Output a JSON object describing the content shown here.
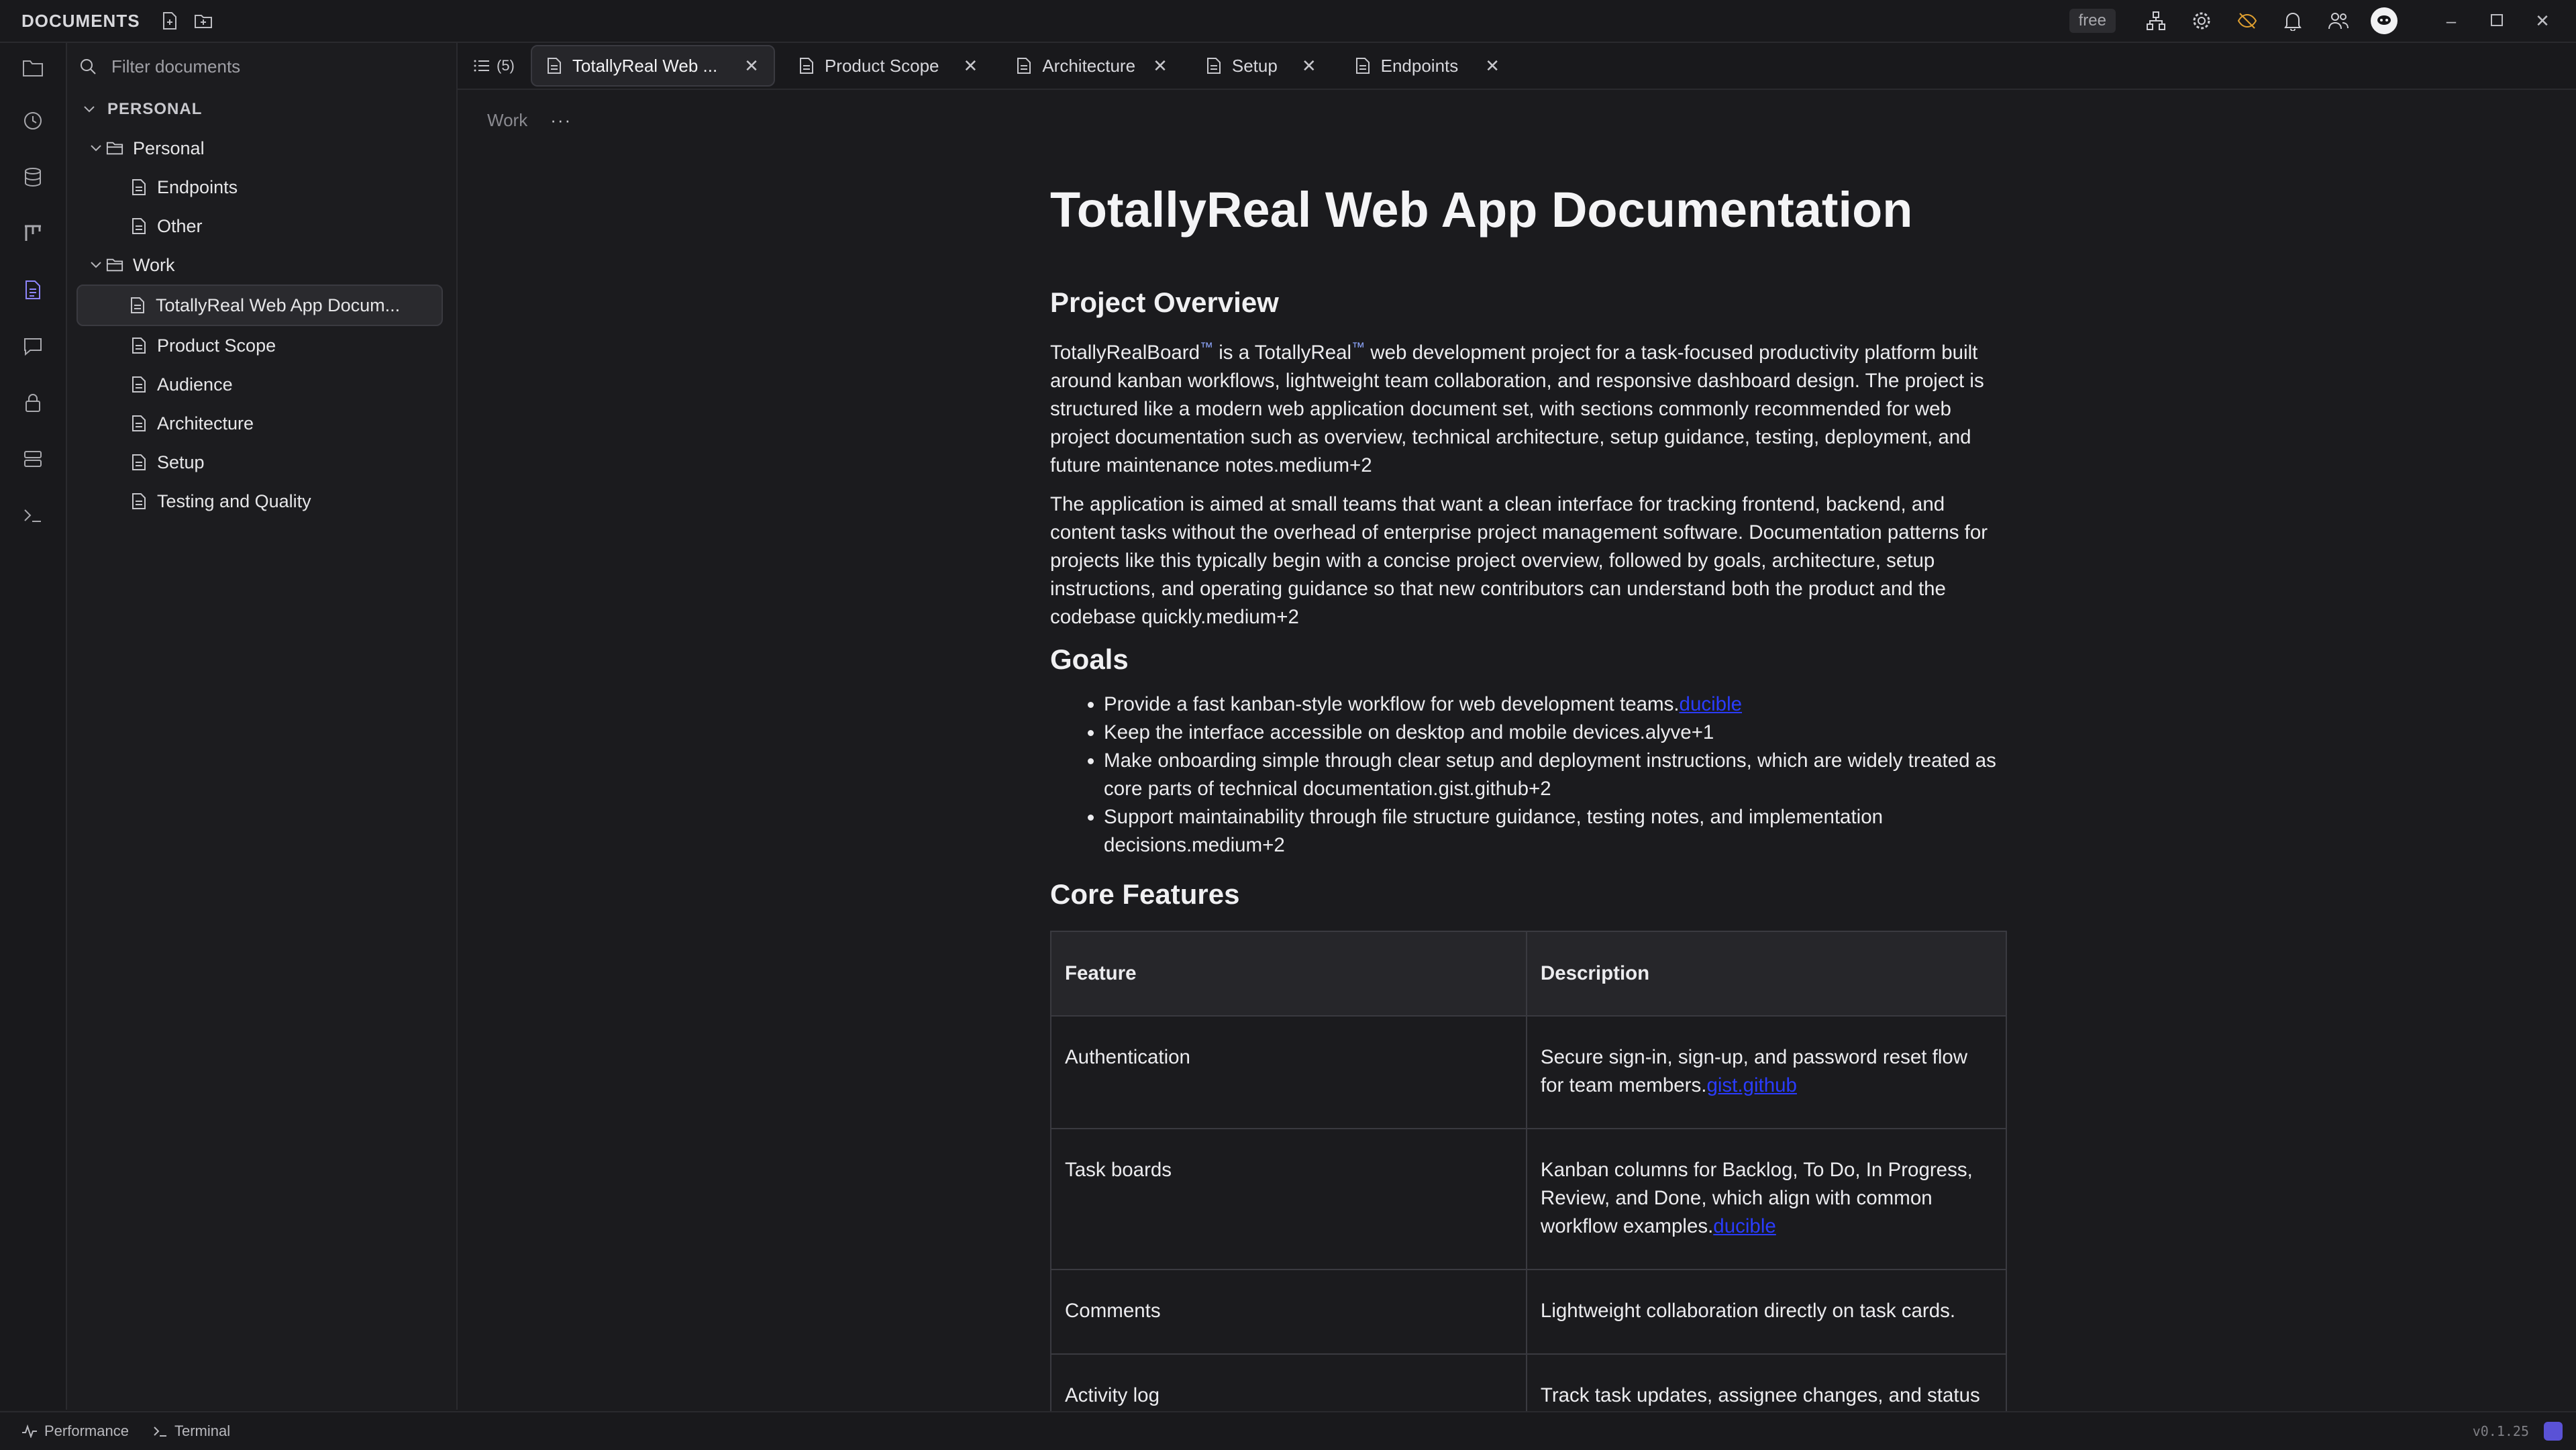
{
  "app": {
    "title": "DOCUMENTS",
    "plan_badge": "free",
    "version": "v0.1.25"
  },
  "sidebar": {
    "filter_placeholder": "Filter documents",
    "section": "PERSONAL",
    "folders": [
      {
        "name": "Personal",
        "items": [
          "Endpoints",
          "Other"
        ]
      },
      {
        "name": "Work",
        "items": [
          "TotallyReal Web App Docum...",
          "Product Scope",
          "Audience",
          "Architecture",
          "Setup",
          "Testing and Quality"
        ]
      }
    ]
  },
  "tabs": {
    "count": "(5)",
    "items": [
      {
        "label": "TotallyReal Web ...",
        "active": true
      },
      {
        "label": "Product Scope"
      },
      {
        "label": "Architecture"
      },
      {
        "label": "Setup"
      },
      {
        "label": "Endpoints"
      }
    ]
  },
  "breadcrumb": {
    "folder": "Work",
    "more": "···"
  },
  "doc": {
    "title": "TotallyReal Web App Documentation",
    "overview_heading": "Project Overview",
    "overview_p1_a": "TotallyRealBoard",
    "overview_tm": "™",
    "overview_p1_b": " is a TotallyReal",
    "overview_p1_c": " web development project for a task-focused productivity platform built around kanban workflows, lightweight team collaboration, and responsive dashboard design. The project is structured like a modern web application document set, with sections commonly recommended for web project documentation such as overview, technical architecture, setup guidance, testing, deployment, and future maintenance notes.medium+2",
    "overview_p2": "The application is aimed at small teams that want a clean interface for tracking frontend, backend, and content tasks without the overhead of enterprise project management software. Documentation patterns for projects like this typically begin with a concise project overview, followed by goals, architecture, setup instructions, and operating guidance so that new contributors can understand both the product and the codebase quickly.medium+2",
    "goals_heading": "Goals",
    "goals": [
      {
        "text": "Provide a fast kanban-style workflow for web development teams.",
        "link": "ducible"
      },
      {
        "text": "Keep the interface accessible on desktop and mobile devices.alyve+1"
      },
      {
        "text": "Make onboarding simple through clear setup and deployment instructions, which are widely treated as core parts of technical documentation.gist.github+2"
      },
      {
        "text": "Support maintainability through file structure guidance, testing notes, and implementation decisions.medium+2"
      }
    ],
    "features_heading": "Core Features",
    "table_headers": {
      "feature": "Feature",
      "description": "Description"
    },
    "features": [
      {
        "feature": "Authentication",
        "description": "Secure sign-in, sign-up, and password reset flow for team members.",
        "link": "gist.github"
      },
      {
        "feature": "Task boards",
        "description": "Kanban columns for Backlog, To Do, In Progress, Review, and Done, which align with common workflow examples.",
        "link": "ducible"
      },
      {
        "feature": "Comments",
        "description": "Lightweight collaboration directly on task cards."
      },
      {
        "feature": "Activity log",
        "description": "Track task updates, assignee changes, and status"
      }
    ]
  },
  "statusbar": {
    "performance": "Performance",
    "terminal": "Terminal"
  }
}
